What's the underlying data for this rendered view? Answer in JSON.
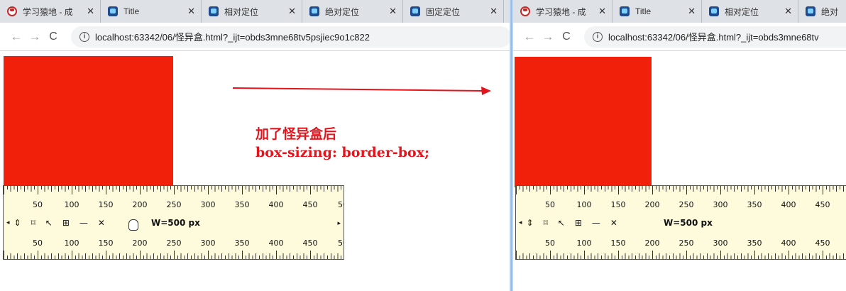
{
  "left": {
    "tabs": [
      {
        "label": "学习猿地 - 成",
        "icon": "hat-icon"
      },
      {
        "label": "Title",
        "icon": "page-icon"
      },
      {
        "label": "相对定位",
        "icon": "page-icon"
      },
      {
        "label": "绝对定位",
        "icon": "page-icon"
      },
      {
        "label": "固定定位",
        "icon": "page-icon"
      }
    ],
    "url": "localhost:63342/06/怪异盒.html?_ijt=obds3mne68tv5psjiec9o1c822"
  },
  "right": {
    "tabs": [
      {
        "label": "学习猿地 - 成",
        "icon": "hat-icon"
      },
      {
        "label": "Title",
        "icon": "page-icon"
      },
      {
        "label": "相对定位",
        "icon": "page-icon"
      },
      {
        "label": "绝对",
        "icon": "page-icon"
      }
    ],
    "url": "localhost:63342/06/怪异盒.html?_ijt=obds3mne68tv"
  },
  "ruler": {
    "numbers": [
      "50",
      "100",
      "150",
      "200",
      "250",
      "300",
      "350",
      "400",
      "450",
      "50"
    ],
    "right_numbers": [
      "50",
      "100",
      "150",
      "200",
      "250",
      "300",
      "350",
      "400",
      "450"
    ],
    "width_label": "W=500 px",
    "tools": [
      "◂",
      "⇕",
      "⌑",
      "↖",
      "⊞",
      "—",
      "✕"
    ],
    "end_glyph": "▸"
  },
  "annotation": {
    "line1": "加了怪异盒后",
    "line2": "box-sizing: border-box;"
  },
  "colors": {
    "box": "#f0200a",
    "annotation": "#e3141c",
    "ruler_bg": "#fdfbdc"
  },
  "glyphs": {
    "close": "✕",
    "back": "←",
    "forward": "→",
    "reload": "C",
    "info": "i"
  }
}
